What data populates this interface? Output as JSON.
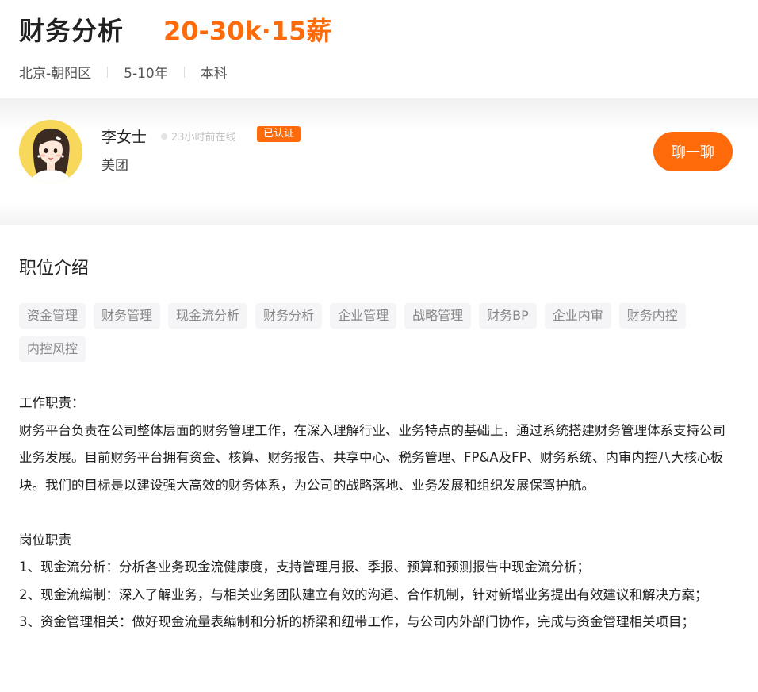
{
  "job": {
    "title": "财务分析",
    "salary": "20-30k·15薪",
    "location": "北京-朝阳区",
    "experience": "5-10年",
    "education": "本科"
  },
  "recruiter": {
    "name": "李女士",
    "online_status": "23小时前在线",
    "verified_label": "已认证",
    "company": "美团",
    "chat_button_label": "聊一聊"
  },
  "section": {
    "title": "职位介绍",
    "tags": [
      "资金管理",
      "财务管理",
      "现金流分析",
      "财务分析",
      "企业管理",
      "战略管理",
      "财务BP",
      "企业内审",
      "财务内控",
      "内控风控"
    ]
  },
  "description": {
    "duties_heading": "工作职责：",
    "duties_text": "财务平台负责在公司整体层面的财务管理工作，在深入理解行业、业务特点的基础上，通过系统搭建财务管理体系支持公司业务发展。目前财务平台拥有资金、核算、财务报告、共享中心、税务管理、FP&A及FP、财务系统、内审内控八大核心板块。我们的目标是以建设强大高效的财务体系，为公司的战略落地、业务发展和组织发展保驾护航。",
    "position_heading": "岗位职责",
    "items": [
      "1、现金流分析：分析各业务现金流健康度，支持管理月报、季报、预算和预测报告中现金流分析；",
      "2、现金流编制：深入了解业务，与相关业务团队建立有效的沟通、合作机制，针对新增业务提出有效建议和解决方案；",
      "3、资金管理相关：做好现金流量表编制和分析的桥梁和纽带工作，与公司内外部门协作，完成与资金管理相关项目；"
    ]
  },
  "colors": {
    "accent": "#ff6a0a",
    "tag_bg": "#f5f5f7"
  }
}
